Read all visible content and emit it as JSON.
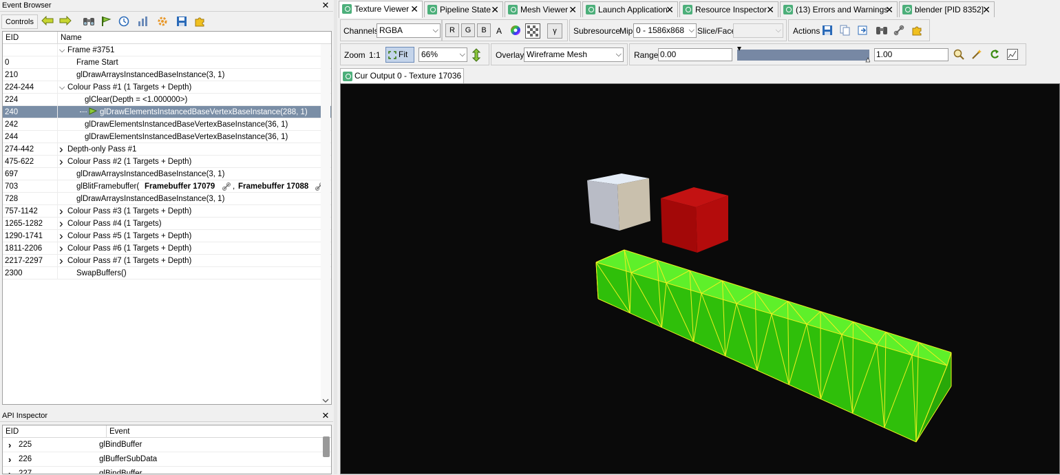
{
  "event_browser": {
    "title": "Event Browser",
    "controls_label": "Controls",
    "col_eid": "EID",
    "col_name": "Name",
    "rows": [
      {
        "eid": "",
        "name": "Frame #3751",
        "indent": 1,
        "expander": "open"
      },
      {
        "eid": "0",
        "name": "Frame Start",
        "indent": 2
      },
      {
        "eid": "210",
        "name": "glDrawArraysInstancedBaseInstance(3, 1)",
        "indent": 2
      },
      {
        "eid": "224-244",
        "name": "Colour Pass #1 (1 Targets + Depth)",
        "indent": 1,
        "expander": "open"
      },
      {
        "eid": "224",
        "name": "glClear(Depth = <1.000000>)",
        "indent": 3
      },
      {
        "eid": "240",
        "name": "glDrawElementsInstancedBaseVertexBaseInstance(288, 1)",
        "indent": 4,
        "selected": true
      },
      {
        "eid": "242",
        "name": "glDrawElementsInstancedBaseVertexBaseInstance(36, 1)",
        "indent": 3
      },
      {
        "eid": "244",
        "name": "glDrawElementsInstancedBaseVertexBaseInstance(36, 1)",
        "indent": 3
      },
      {
        "eid": "274-442",
        "name": "Depth-only Pass #1",
        "indent": 1,
        "expander": "closed"
      },
      {
        "eid": "475-622",
        "name": "Colour Pass #2 (1 Targets + Depth)",
        "indent": 1,
        "expander": "closed"
      },
      {
        "eid": "697",
        "name": "glDrawArraysInstancedBaseInstance(3, 1)",
        "indent": 2
      },
      {
        "eid": "703",
        "name": "glBlitFramebuffer(",
        "indent": 2,
        "blit": true
      },
      {
        "eid": "728",
        "name": "glDrawArraysInstancedBaseInstance(3, 1)",
        "indent": 2
      },
      {
        "eid": "757-1142",
        "name": "Colour Pass #3 (1 Targets + Depth)",
        "indent": 1,
        "expander": "closed"
      },
      {
        "eid": "1265-1282",
        "name": "Colour Pass #4 (1 Targets)",
        "indent": 1,
        "expander": "closed"
      },
      {
        "eid": "1290-1741",
        "name": "Colour Pass #5 (1 Targets + Depth)",
        "indent": 1,
        "expander": "closed"
      },
      {
        "eid": "1811-2206",
        "name": "Colour Pass #6 (1 Targets + Depth)",
        "indent": 1,
        "expander": "closed"
      },
      {
        "eid": "2217-2297",
        "name": "Colour Pass #7 (1 Targets + Depth)",
        "indent": 1,
        "expander": "closed"
      },
      {
        "eid": "2300",
        "name": "SwapBuffers()",
        "indent": 2
      }
    ],
    "blit_src": "Framebuffer 17079",
    "blit_dst": "Framebuffer 17088"
  },
  "api_inspector": {
    "title": "API Inspector",
    "col_eid": "EID",
    "col_event": "Event",
    "rows": [
      {
        "eid": "225",
        "event": "glBindBuffer"
      },
      {
        "eid": "226",
        "event": "glBufferSubData"
      },
      {
        "eid": "227",
        "event": "glBindBuffer"
      }
    ]
  },
  "tabs": [
    {
      "label": "Texture Viewer",
      "active": true
    },
    {
      "label": "Pipeline State"
    },
    {
      "label": "Mesh Viewer"
    },
    {
      "label": "Launch Application"
    },
    {
      "label": "Resource Inspector"
    },
    {
      "label": "(13) Errors and Warnings"
    },
    {
      "label": "blender [PID 8352]"
    }
  ],
  "toolbar": {
    "channels_label": "Channels",
    "channels_value": "RGBA",
    "r": "R",
    "g": "G",
    "b": "B",
    "a": "A",
    "gamma": "γ",
    "subresource_label": "Subresource",
    "mip_label": "Mip",
    "mip_value": "0 - 1586x868",
    "slice_label": "Slice/Face",
    "actions_label": "Actions",
    "zoom_label": "Zoom",
    "zoom_1to1": "1:1",
    "fit_label": "Fit",
    "zoom_value": "66%",
    "overlay_label": "Overlay",
    "overlay_value": "Wireframe Mesh",
    "range_label": "Range",
    "range_min": "0.00",
    "range_max": "1.00"
  },
  "viewport": {
    "tab_label": "Cur Output 0 - Texture 17036",
    "bg": "#0a0a0a",
    "wire_color": "#f0f020",
    "box_color": "#33d60a",
    "red_cube": "#cc1010",
    "white_cube": "#d7dde8"
  },
  "colors": {
    "selected_row": "#7a8ea6",
    "tab_icon": "#4caf7a"
  }
}
